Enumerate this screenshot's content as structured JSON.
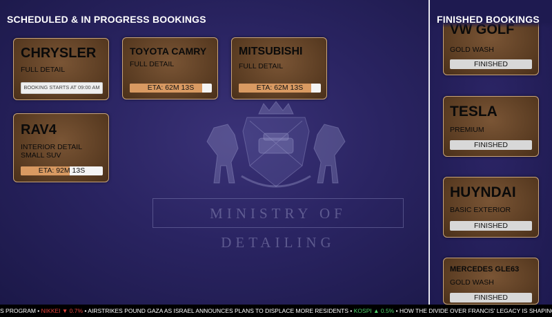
{
  "main": {
    "heading": "SCHEDULED & IN PROGRESS BOOKINGS",
    "bookings": [
      {
        "make": "CHRYSLER",
        "service": "FULL DETAIL",
        "status": "BOOKING STARTS AT 09:00 AM"
      },
      {
        "make": "TOYOTA CAMRY",
        "service": "FULL DETAIL",
        "eta": "ETA: 62M 13S",
        "progress": 0.88
      },
      {
        "make": "MITSUBISHI",
        "service": "FULL DETAIL",
        "eta": "ETA: 62M 13S",
        "progress": 0.88
      },
      {
        "make": "RAV4",
        "service": "INTERIOR DETAIL",
        "service2": "SMALL SUV",
        "eta": "ETA: 92M 13S",
        "progress": 0.6
      }
    ],
    "logo_icon": "crown-crest-horses-icon",
    "motto": "MINISTRY OF DETAILING"
  },
  "finished": {
    "heading": "FINISHED BOOKINGS",
    "items": [
      {
        "make": "VW GOLF",
        "service": "GOLD WASH",
        "status": "FINISHED"
      },
      {
        "make": "TESLA",
        "service": "PREMIUM",
        "status": "FINISHED"
      },
      {
        "make": "HUYNDAI",
        "service": "BASIC EXTERIOR",
        "status": "FINISHED"
      },
      {
        "make": "MERCEDES GLE63",
        "service": "GOLD WASH",
        "status": "FINISHED"
      }
    ]
  },
  "ticker": {
    "t1": "S PROGRAM •",
    "nikkei_label": "NIKKEI ▼ 0.7%",
    "t2": "• AIRSTRIKES POUND GAZA AS ISRAEL ANNOUNCES PLANS TO DISPLACE MORE RESIDENTS •",
    "kospi_label": "KOSPI ▲ 0.5%",
    "t3": "• HOW THE DIVIDE OVER FRANCIS' LEGACY IS SHAPING THE CONTEST FOR O"
  },
  "colors": {
    "card_border": "#caa57a",
    "progress_fill": "#d99a62",
    "down": "#e0433b",
    "up": "#4fd16a"
  }
}
